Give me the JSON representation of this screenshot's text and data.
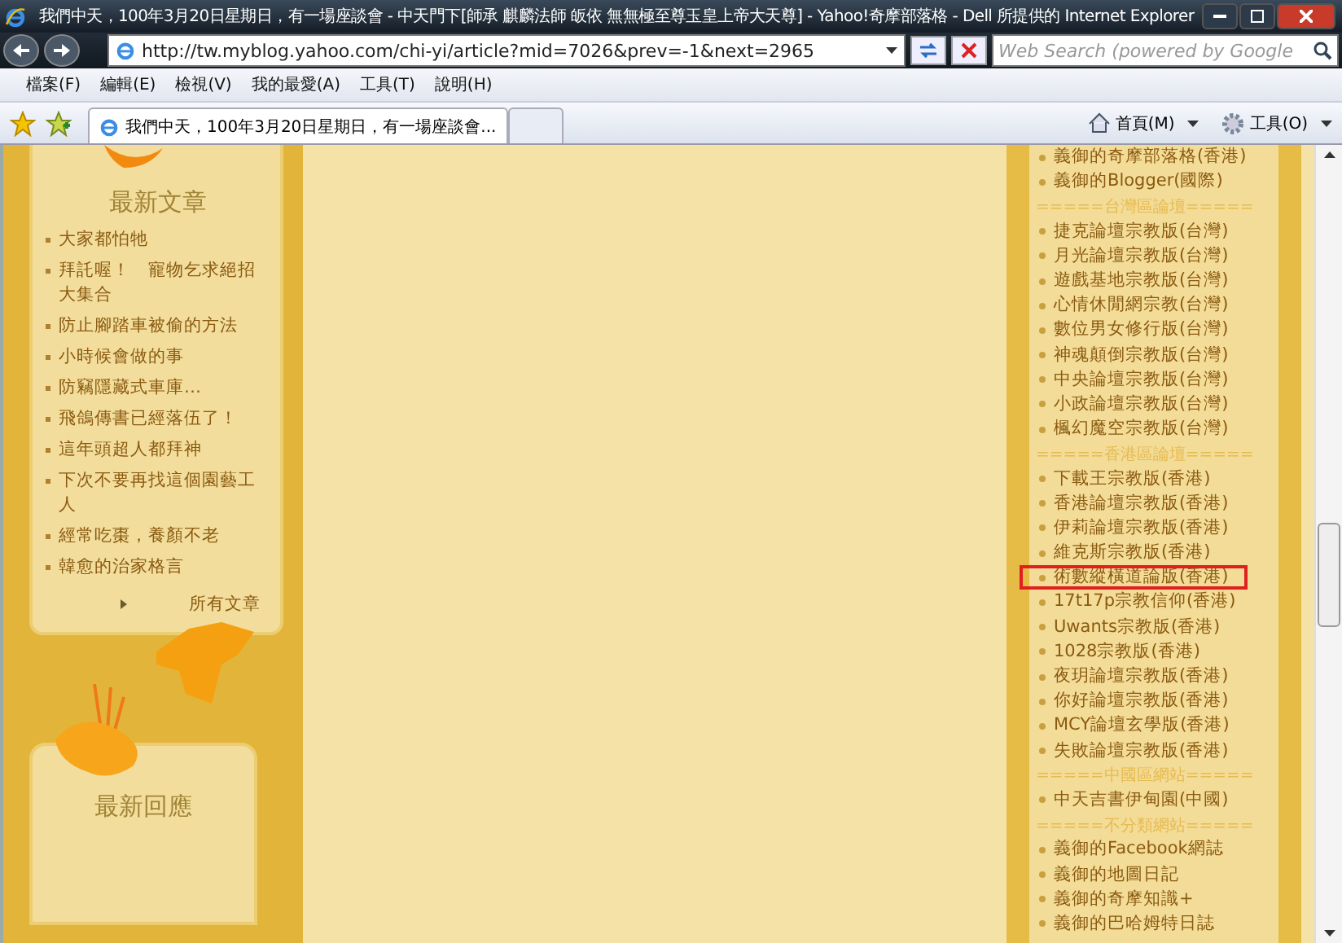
{
  "window": {
    "title": "我們中天，100年3月20日星期日，有一場座談會 - 中天門下[師承 麒麟法師 皈依 無無極至尊玉皇上帝大天尊] - Yahoo!奇摩部落格 - Dell 所提供的 Internet Explorer"
  },
  "toolbar": {
    "address": "http://tw.myblog.yahoo.com/chi-yi/article?mid=7026&prev=-1&next=2965",
    "search_placeholder": "Web Search (powered by Google"
  },
  "menu": [
    "檔案(F)",
    "編輯(E)",
    "檢視(V)",
    "我的最愛(A)",
    "工具(T)",
    "說明(H)"
  ],
  "tabs": [
    {
      "label": "我們中天，100年3月20日星期日，有一場座談會...",
      "selected": true
    },
    {
      "selected": false
    }
  ],
  "command_bar": [
    "首頁(M)",
    "工具(O)"
  ],
  "left_sidebar": {
    "recent_posts": {
      "title": "最新文章",
      "items": [
        "大家都怕牠",
        "拜託喔！　寵物乞求絕招大集合",
        "防止腳踏車被偷的方法",
        "小時候會做的事",
        "防竊隱藏式車庫…",
        "飛鴿傳書已經落伍了！",
        "這年頭超人都拜神",
        "下次不要再找這個園藝工人",
        "經常吃棗，養顏不老",
        "韓愈的治家格言"
      ],
      "all_link": "所有文章"
    },
    "recent_comments": {
      "title": "最新回應"
    }
  },
  "right_sidebar": {
    "items": [
      {
        "kind": "link",
        "text": "義御的奇摩部落格(香港)",
        "highlighted": false
      },
      {
        "kind": "link",
        "text": "義御的Blogger(國際)",
        "highlighted": false
      },
      {
        "kind": "divider",
        "text": "=====台灣區論壇====="
      },
      {
        "kind": "link",
        "text": "捷克論壇宗教版(台灣)",
        "highlighted": false
      },
      {
        "kind": "link",
        "text": "月光論壇宗教版(台灣)",
        "highlighted": false
      },
      {
        "kind": "link",
        "text": "遊戲基地宗教版(台灣)",
        "highlighted": false
      },
      {
        "kind": "link",
        "text": "心情休閒網宗教(台灣)",
        "highlighted": false
      },
      {
        "kind": "link",
        "text": "數位男女修行版(台灣)",
        "highlighted": false
      },
      {
        "kind": "link",
        "text": "神魂顛倒宗教版(台灣)",
        "highlighted": false
      },
      {
        "kind": "link",
        "text": "中央論壇宗教版(台灣)",
        "highlighted": false
      },
      {
        "kind": "link",
        "text": "小政論壇宗教版(台灣)",
        "highlighted": false
      },
      {
        "kind": "link",
        "text": "楓幻魔空宗教版(台灣)",
        "highlighted": false
      },
      {
        "kind": "divider",
        "text": "=====香港區論壇====="
      },
      {
        "kind": "link",
        "text": "下載王宗教版(香港)",
        "highlighted": false
      },
      {
        "kind": "link",
        "text": "香港論壇宗教版(香港)",
        "highlighted": false
      },
      {
        "kind": "link",
        "text": "伊莉論壇宗教版(香港)",
        "highlighted": false
      },
      {
        "kind": "link",
        "text": "維克斯宗教版(香港)",
        "highlighted": false
      },
      {
        "kind": "link",
        "text": "術數縱橫道論版(香港)",
        "highlighted": true
      },
      {
        "kind": "link",
        "text": "17t17p宗教信仰(香港)",
        "highlighted": false
      },
      {
        "kind": "link",
        "text": "Uwants宗教版(香港)",
        "highlighted": false
      },
      {
        "kind": "link",
        "text": "1028宗教版(香港)",
        "highlighted": false
      },
      {
        "kind": "link",
        "text": "夜玥論壇宗教版(香港)",
        "highlighted": false
      },
      {
        "kind": "link",
        "text": "你好論壇宗教版(香港)",
        "highlighted": false
      },
      {
        "kind": "link",
        "text": "MCY論壇玄學版(香港)",
        "highlighted": false
      },
      {
        "kind": "link",
        "text": "失敗論壇宗教版(香港)",
        "highlighted": false
      },
      {
        "kind": "divider",
        "text": "=====中國區網站====="
      },
      {
        "kind": "link",
        "text": "中天吉書伊甸園(中國)",
        "highlighted": false
      },
      {
        "kind": "divider",
        "text": "=====不分類網站====="
      },
      {
        "kind": "link",
        "text": "義御的Facebook網誌",
        "highlighted": false
      },
      {
        "kind": "link",
        "text": "義御的地圖日記",
        "highlighted": false
      },
      {
        "kind": "link",
        "text": "義御的奇摩知識+",
        "highlighted": false
      },
      {
        "kind": "link",
        "text": "義御的巴哈姆特日誌",
        "highlighted": false
      }
    ]
  }
}
